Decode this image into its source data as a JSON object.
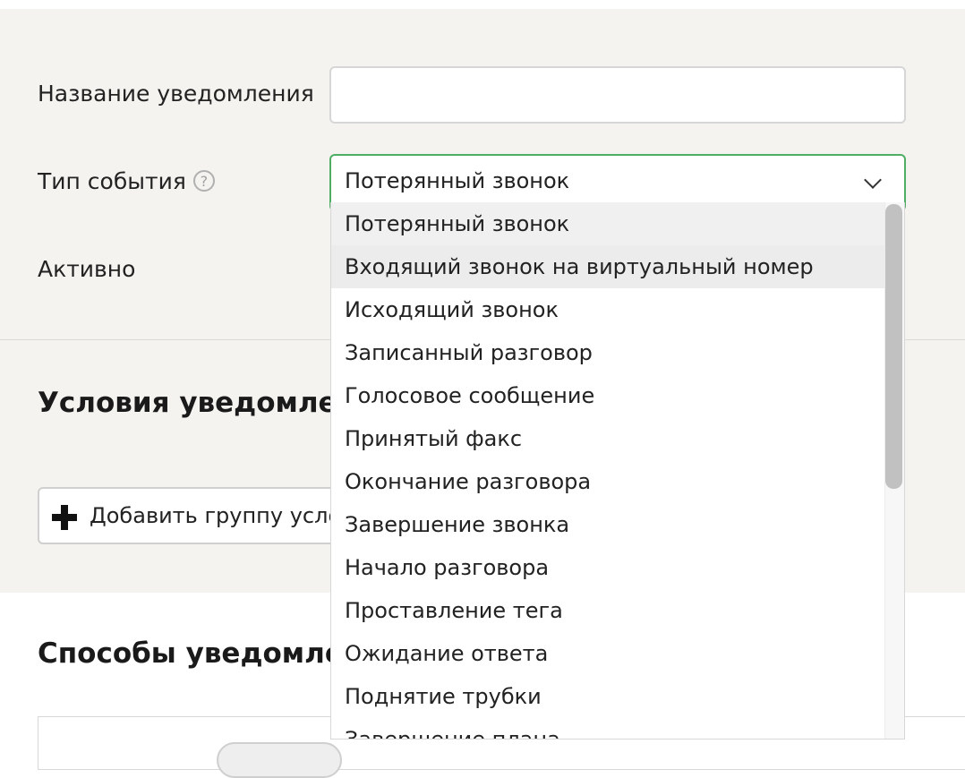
{
  "form": {
    "name_label": "Название уведомления",
    "name_value": "",
    "type_label": "Тип события",
    "help_glyph": "?",
    "type_selected": "Потерянный звонок",
    "active_label": "Активно"
  },
  "conditions": {
    "heading": "Условия уведомлени",
    "add_group_label": "Добавить группу усло"
  },
  "methods": {
    "heading": "Способы уведомлен"
  },
  "dropdown": {
    "options": [
      "Потерянный звонок",
      "Входящий звонок на виртуальный номер",
      "Исходящий звонок",
      "Записанный разговор",
      "Голосовое сообщение",
      "Принятый факс",
      "Окончание разговора",
      "Завершение звонка",
      "Начало разговора",
      "Проставление тега",
      "Ожидание ответа",
      "Поднятие трубки",
      "Завершение плана"
    ],
    "selected_index": 0,
    "hovered_index": 1,
    "scroll_thumb_fraction": 0.53
  },
  "colors": {
    "background": "#f4f3f0",
    "focus_border": "#4fae64",
    "highlight": "#f0f0f0"
  }
}
